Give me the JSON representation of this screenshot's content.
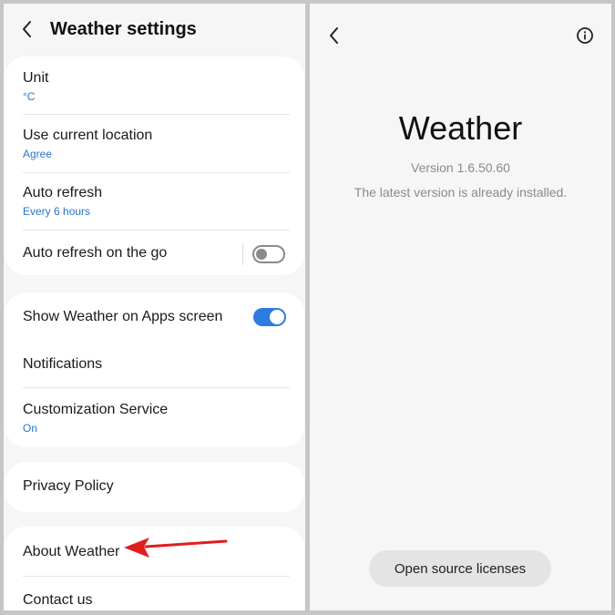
{
  "settings": {
    "title": "Weather settings",
    "back_icon": "chevron-left-icon",
    "groups": [
      [
        {
          "label": "Unit",
          "sub": "°C"
        },
        {
          "label": "Use current location",
          "sub": "Agree"
        },
        {
          "label": "Auto refresh",
          "sub": "Every 6 hours"
        },
        {
          "label": "Auto refresh on the go",
          "toggle": "off"
        }
      ],
      [
        {
          "label": "Show Weather on Apps screen",
          "toggle": "on"
        },
        {
          "label": "Notifications"
        },
        {
          "label": "Customization Service",
          "sub": "On"
        }
      ],
      [
        {
          "label": "Privacy Policy"
        }
      ],
      [
        {
          "label": "About Weather"
        },
        {
          "label": "Contact us"
        }
      ]
    ]
  },
  "about": {
    "back_icon": "chevron-left-icon",
    "info_icon": "info-circle-icon",
    "app_name": "Weather",
    "version": "Version 1.6.50.60",
    "status": "The latest version is already installed.",
    "licenses_button": "Open source licenses"
  },
  "colors": {
    "accent": "#2d7de0",
    "subtext": "#2a76c8",
    "annotation": "#e01e1e"
  }
}
